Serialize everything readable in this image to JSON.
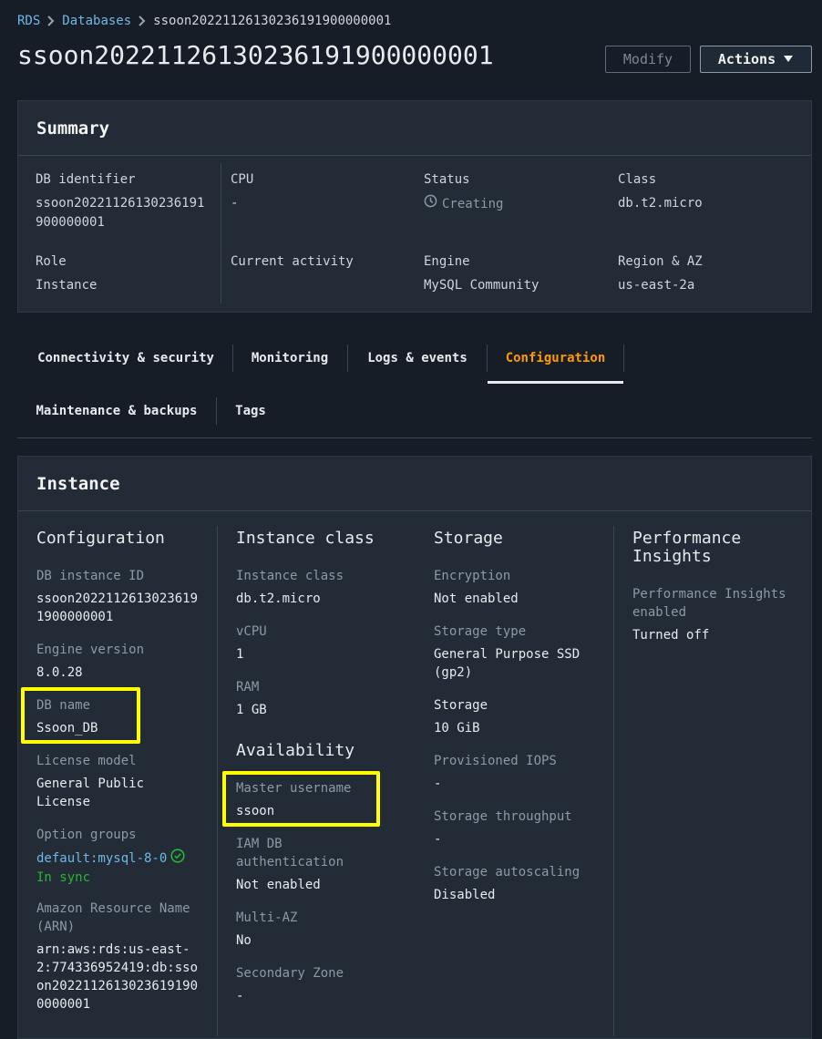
{
  "breadcrumb": {
    "items": [
      "RDS",
      "Databases",
      "ssoon20221126130236191900000001"
    ]
  },
  "page": {
    "title": "ssoon20221126130236191900000001",
    "modify_label": "Modify",
    "actions_label": "Actions"
  },
  "summary": {
    "title": "Summary",
    "db_identifier_label": "DB identifier",
    "db_identifier_line1": "ssoon20221126130236191",
    "db_identifier_line2": "900000001",
    "cpu_label": "CPU",
    "cpu_value": "-",
    "status_label": "Status",
    "status_value": "Creating",
    "class_label": "Class",
    "class_value": "db.t2.micro",
    "role_label": "Role",
    "role_value": "Instance",
    "activity_label": "Current activity",
    "engine_label": "Engine",
    "engine_value": "MySQL Community",
    "region_label": "Region & AZ",
    "region_value": "us-east-2a"
  },
  "tabs": {
    "connectivity": "Connectivity & security",
    "monitoring": "Monitoring",
    "logs": "Logs & events",
    "configuration": "Configuration",
    "maintenance": "Maintenance & backups",
    "tags": "Tags",
    "active": "Configuration"
  },
  "instance": {
    "title": "Instance",
    "configuration": {
      "title": "Configuration",
      "db_instance_id_label": "DB instance ID",
      "db_instance_id_line1": "ssoon2022112613023619",
      "db_instance_id_line2": "1900000001",
      "engine_version_label": "Engine version",
      "engine_version_value": "8.0.28",
      "db_name_label": "DB name",
      "db_name_value": "Ssoon_DB",
      "license_model_label": "License model",
      "license_model_line1": "General Public",
      "license_model_line2": "License",
      "option_groups_label": "Option groups",
      "option_group_link": "default:mysql-8-0",
      "option_group_status": "In sync",
      "arn_label_line1": "Amazon Resource Name",
      "arn_label_line2": "(ARN)",
      "arn_line1": "arn:aws:rds:us-east-",
      "arn_line2": "2:774336952419:db:sso",
      "arn_line3": "on2022112613023619190",
      "arn_line4": "0000001"
    },
    "instance_class": {
      "title": "Instance class",
      "class_label": "Instance class",
      "class_value": "db.t2.micro",
      "vcpu_label": "vCPU",
      "vcpu_value": "1",
      "ram_label": "RAM",
      "ram_value": "1 GB",
      "availability_title": "Availability",
      "master_username_label": "Master username",
      "master_username_value": "ssoon",
      "iam_label_line1": "IAM DB",
      "iam_label_line2": "authentication",
      "iam_value": "Not enabled",
      "multi_az_label": "Multi-AZ",
      "multi_az_value": "No",
      "secondary_zone_label": "Secondary Zone",
      "secondary_zone_value": "-"
    },
    "storage": {
      "title": "Storage",
      "encryption_label": "Encryption",
      "encryption_value": "Not enabled",
      "storage_type_label": "Storage type",
      "storage_type_line1": "General Purpose SSD",
      "storage_type_line2": "(gp2)",
      "storage_label": "Storage",
      "storage_value": "10 GiB",
      "iops_label": "Provisioned IOPS",
      "iops_value": "-",
      "throughput_label": "Storage throughput",
      "throughput_value": "-",
      "autoscaling_label": "Storage autoscaling",
      "autoscaling_value": "Disabled"
    },
    "performance": {
      "title_line1": "Performance",
      "title_line2": "Insights",
      "enabled_label_line1": "Performance Insights",
      "enabled_label_line2": "enabled",
      "enabled_value": "Turned off"
    }
  },
  "colors": {
    "background": "#161d26",
    "panel": "#222b36",
    "link": "#6fb8e4",
    "active_tab": "#ff9900",
    "success": "#2bb534",
    "highlight": "#ffff00"
  }
}
